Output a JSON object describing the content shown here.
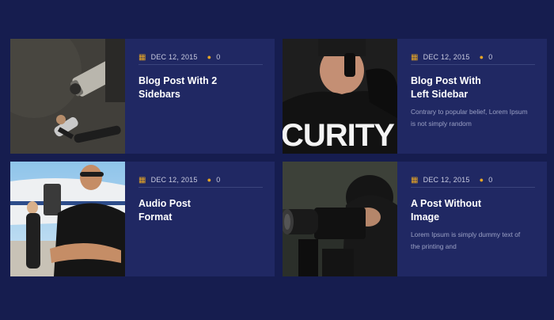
{
  "posts": [
    {
      "date": "DEC 12, 2015",
      "comments": "0",
      "title_line1": "Blog Post With 2",
      "title_line2": "Sidebars",
      "excerpt": "",
      "image": "security-camera-photo"
    },
    {
      "date": "DEC 12, 2015",
      "comments": "0",
      "title_line1": "Blog Post With",
      "title_line2": "Left Sidebar",
      "excerpt": "Contrary to popular belief, Lorem Ipsum is not simply random",
      "image": "security-guard-photo",
      "image_text": "CURITY"
    },
    {
      "date": "DEC 12, 2015",
      "comments": "0",
      "title_line1": "Audio Post",
      "title_line2": "Format",
      "excerpt": "",
      "image": "bodyguard-jet-photo"
    },
    {
      "date": "DEC 12, 2015",
      "comments": "0",
      "title_line1": "A Post Without",
      "title_line2": "Image",
      "excerpt": "Lorem Ipsum is simply dummy text of the printing and",
      "image": "photographer-camera-photo"
    }
  ],
  "colors": {
    "background": "#161d4f",
    "card": "#202863",
    "accent": "#e6a525"
  }
}
